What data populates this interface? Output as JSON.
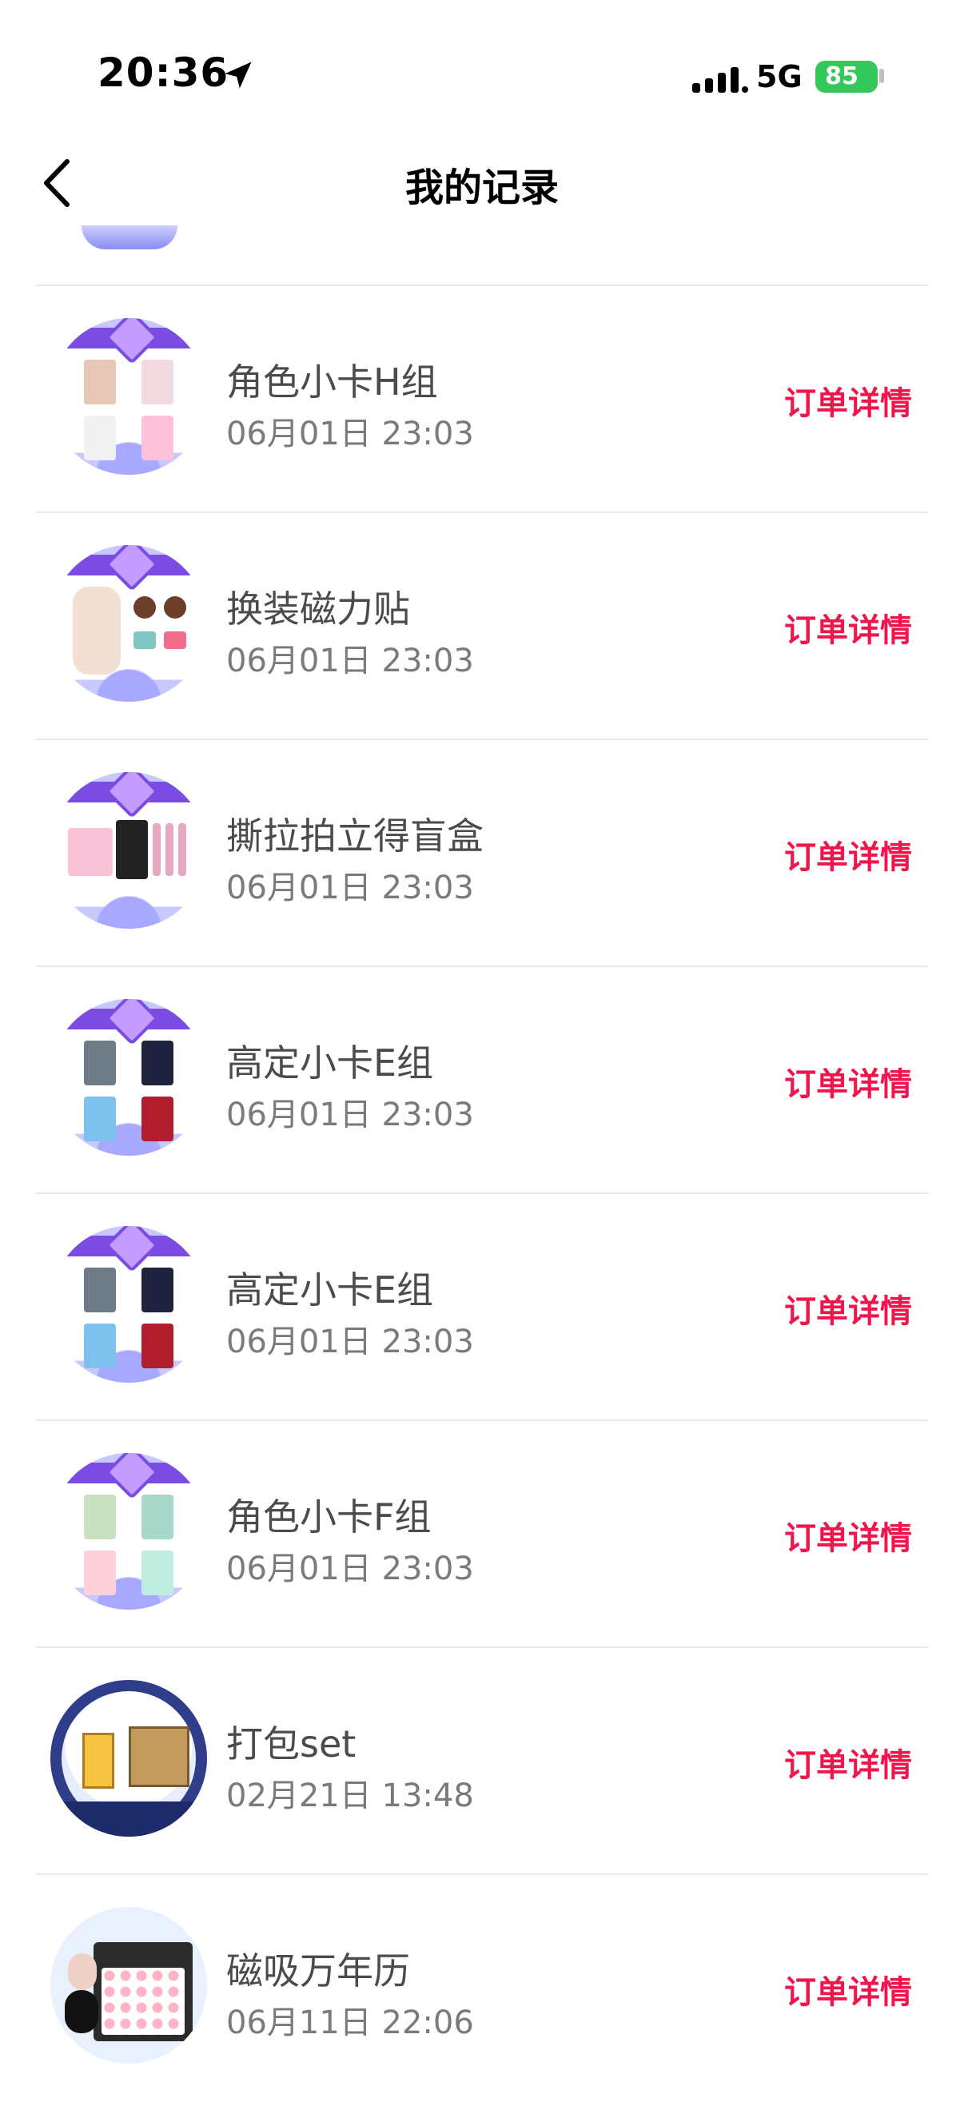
{
  "status_bar": {
    "time": "20:36",
    "network": "5G",
    "battery": "85"
  },
  "header": {
    "title": "我的记录",
    "back_icon": "chevron-left-icon"
  },
  "orders": [
    {
      "name": "角色小卡H组",
      "date": "06月01日 23:03",
      "action": "订单详情",
      "thumb": "photo-cards"
    },
    {
      "name": "换装磁力贴",
      "date": "06月01日 23:03",
      "action": "订单详情",
      "thumb": "dressup-magnet"
    },
    {
      "name": "撕拉拍立得盲盒",
      "date": "06月01日 23:03",
      "action": "订单详情",
      "thumb": "polaroid-box"
    },
    {
      "name": "高定小卡E组",
      "date": "06月01日 23:03",
      "action": "订单详情",
      "thumb": "photo-cards-dark"
    },
    {
      "name": "高定小卡E组",
      "date": "06月01日 23:03",
      "action": "订单详情",
      "thumb": "photo-cards-dark"
    },
    {
      "name": "角色小卡F组",
      "date": "06月01日 23:03",
      "action": "订单详情",
      "thumb": "photo-cards-light"
    },
    {
      "name": "打包set",
      "date": "02月21日 13:48",
      "action": "订单详情",
      "thumb": "snow-globe-set"
    },
    {
      "name": "磁吸万年历",
      "date": "06月11日 22:06",
      "action": "订单详情",
      "thumb": "magnet-calendar"
    }
  ],
  "colors": {
    "accent": "#f0164b",
    "battery": "#34c759",
    "divider": "#e7e7e7"
  }
}
